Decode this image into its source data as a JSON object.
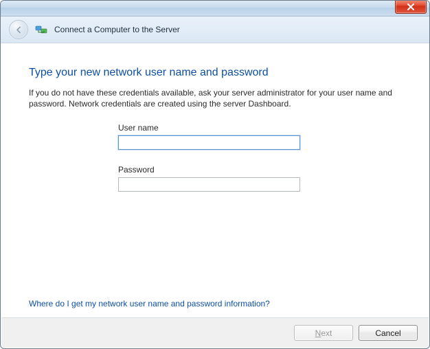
{
  "titlebar": {},
  "header": {
    "title": "Connect a Computer to the Server"
  },
  "main": {
    "heading": "Type your new network user name and password",
    "description": "If you do not have these credentials available, ask your server administrator for your user name and password. Network credentials are created using the server Dashboard.",
    "username_label": "User name",
    "username_value": "",
    "password_label": "Password",
    "password_value": "",
    "help_link": "Where do I get my network user name and password information?"
  },
  "footer": {
    "next_label": "Next",
    "next_underline_index": 0,
    "next_enabled": false,
    "cancel_label": "Cancel"
  }
}
